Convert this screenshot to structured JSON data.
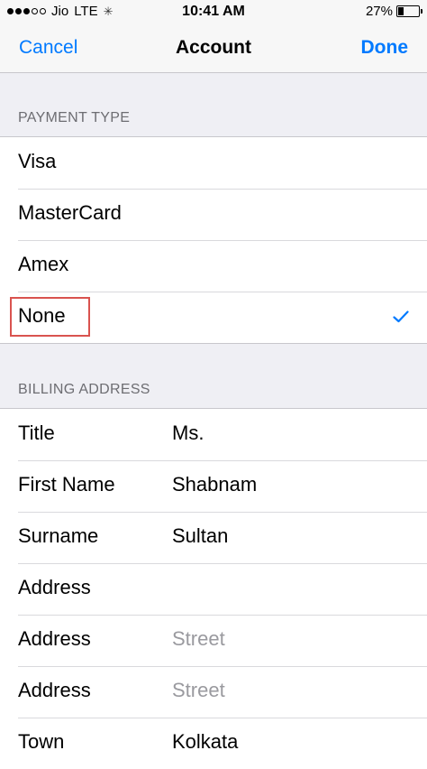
{
  "status_bar": {
    "carrier": "Jio",
    "network": "LTE",
    "time": "10:41 AM",
    "battery": "27%"
  },
  "nav": {
    "cancel_label": "Cancel",
    "title": "Account",
    "done_label": "Done"
  },
  "payment": {
    "header": "PAYMENT TYPE",
    "items": [
      {
        "label": "Visa"
      },
      {
        "label": "MasterCard"
      },
      {
        "label": "Amex"
      },
      {
        "label": "None",
        "selected": true
      }
    ]
  },
  "billing": {
    "header": "BILLING ADDRESS",
    "rows": [
      {
        "label": "Title",
        "value": "Ms."
      },
      {
        "label": "First Name",
        "value": "Shabnam"
      },
      {
        "label": "Surname",
        "value": "Sultan"
      },
      {
        "label": "Address",
        "value": ""
      },
      {
        "label": "Address",
        "placeholder": "Street"
      },
      {
        "label": "Address",
        "placeholder": "Street"
      },
      {
        "label": "Town",
        "value": "Kolkata"
      }
    ]
  }
}
